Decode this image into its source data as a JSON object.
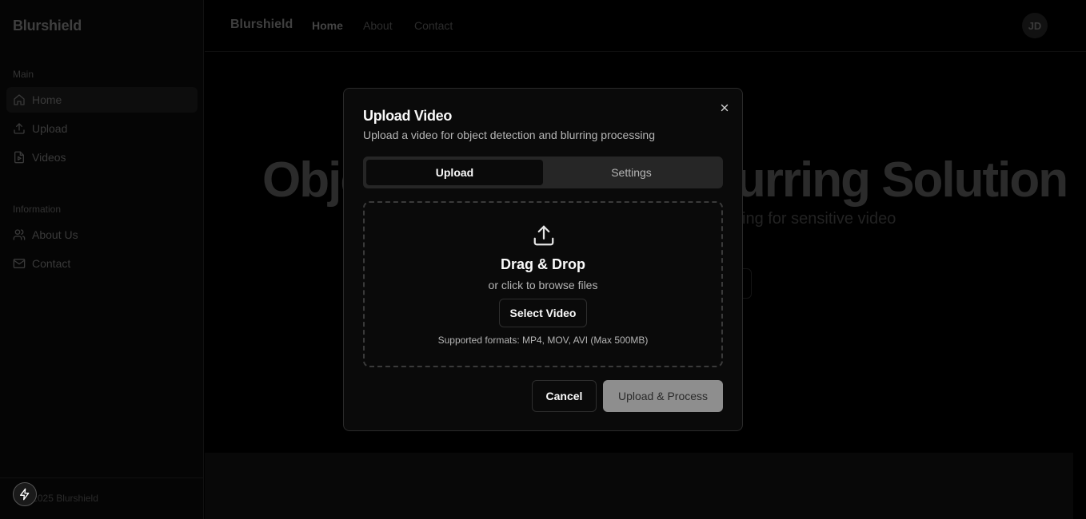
{
  "sidebar": {
    "brand": "Blurshield",
    "groups": [
      {
        "label": "Main"
      },
      {
        "label": "Information"
      }
    ],
    "items": [
      {
        "label": "Home",
        "icon": "home-icon"
      },
      {
        "label": "Upload",
        "icon": "upload-icon"
      },
      {
        "label": "Videos",
        "icon": "video-file-icon"
      },
      {
        "label": "About Us",
        "icon": "users-icon"
      },
      {
        "label": "Contact",
        "icon": "mail-icon"
      }
    ],
    "footer": "© 2025 Blurshield"
  },
  "topbar": {
    "brand": "Blurshield",
    "links": [
      "Home",
      "About",
      "Contact"
    ],
    "avatar_initials": "JD"
  },
  "hero": {
    "title": "Object Detection & Blurring Solution",
    "subtitle": "Automated detection and blurring for sensitive video"
  },
  "modal": {
    "title": "Upload Video",
    "description": "Upload a video for object detection and blurring processing",
    "tabs": [
      {
        "label": "Upload",
        "active": true
      },
      {
        "label": "Settings",
        "active": false
      }
    ],
    "dropzone": {
      "title": "Drag & Drop",
      "subtitle": "or click to browse files",
      "button": "Select Video",
      "formats": "Supported formats: MP4, MOV, AVI (Max 500MB)"
    },
    "cancel_label": "Cancel",
    "submit_label": "Upload & Process"
  },
  "colors": {
    "background": "#000000",
    "modal_bg": "#0a0a0a",
    "primary_disabled": "#8e8e8e"
  }
}
